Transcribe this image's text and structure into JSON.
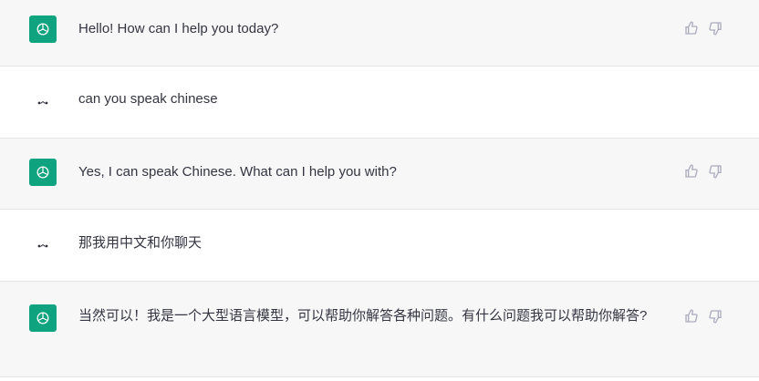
{
  "conversation": [
    {
      "role": "assistant",
      "text": "Hello! How can I help you today?"
    },
    {
      "role": "user",
      "text": "can you speak chinese"
    },
    {
      "role": "assistant",
      "text": "Yes, I can speak Chinese. What can I help you with?"
    },
    {
      "role": "user",
      "text": "那我用中文和你聊天"
    },
    {
      "role": "assistant",
      "text": "当然可以！我是一个大型语言模型，可以帮助你解答各种问题。有什么问题我可以帮助你解答?"
    }
  ],
  "icons": {
    "assistant_avatar": "openai-logo-icon",
    "user_avatar": "user-avatar-icon",
    "like": "thumbs-up-icon",
    "dislike": "thumbs-down-icon"
  },
  "colors": {
    "assistant_bg": "#f7f7f8",
    "user_bg": "#ffffff",
    "avatar_green": "#10a37f",
    "text": "#343541",
    "icon_gray": "#acacbe"
  }
}
